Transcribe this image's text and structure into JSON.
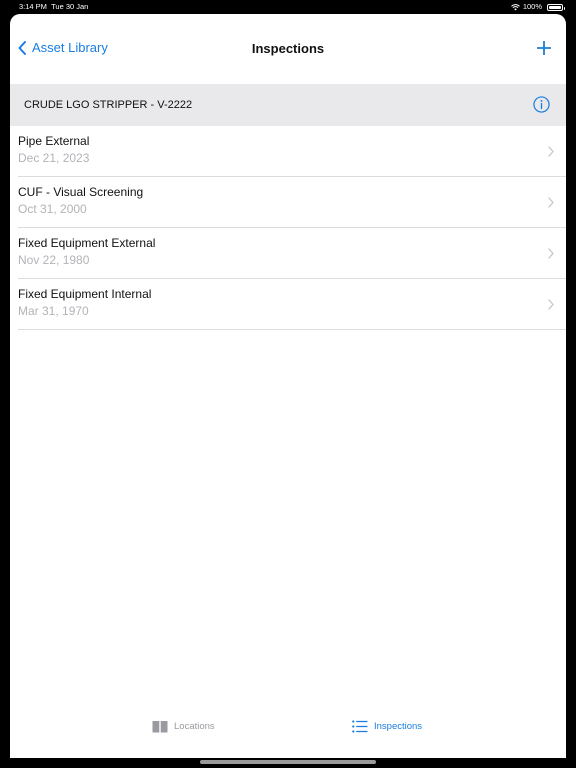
{
  "status": {
    "time": "3:14 PM",
    "date": "Tue 30 Jan",
    "battery": "100%",
    "battery_level": 1.0
  },
  "nav": {
    "back_label": "Asset Library",
    "title": "Inspections",
    "add_icon": "plus-icon"
  },
  "asset": {
    "name": "CRUDE LGO STRIPPER - V-2222",
    "info_icon": "info-icon"
  },
  "inspections": [
    {
      "title": "Pipe External",
      "date": "Dec 21, 2023"
    },
    {
      "title": "CUF - Visual Screening",
      "date": "Oct 31, 2000"
    },
    {
      "title": "Fixed Equipment External",
      "date": "Nov 22, 1980"
    },
    {
      "title": "Fixed Equipment Internal",
      "date": "Mar 31, 1970"
    }
  ],
  "tabs": [
    {
      "label": "Locations",
      "icon": "book-icon",
      "selected": false
    },
    {
      "label": "Inspections",
      "icon": "list-icon",
      "selected": true
    }
  ],
  "colors": {
    "accent": "#1a7ee0",
    "header_bg": "#e9e9eb",
    "secondary_text": "#b3b3b8",
    "inactive_tab": "#9a9aa0"
  }
}
